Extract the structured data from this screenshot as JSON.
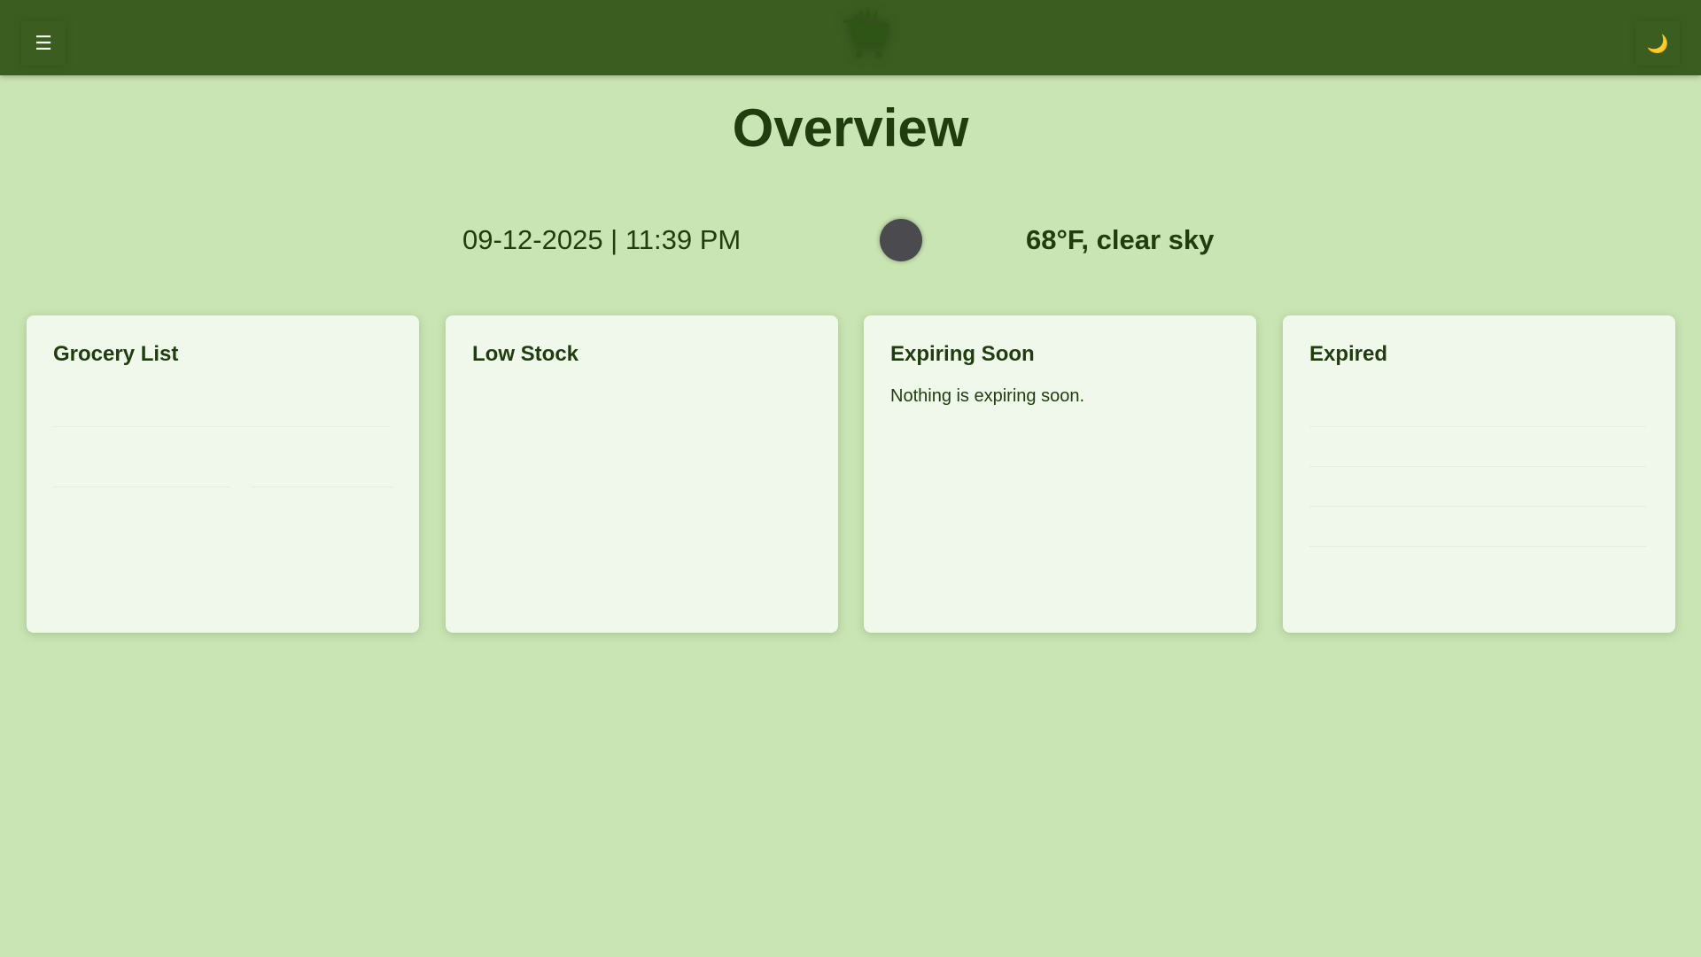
{
  "header": {
    "menu_icon": "☰",
    "theme_icon": "🌙",
    "logo_name": "grocery-cart-logo",
    "colors": {
      "bar": "#3b5e20",
      "background": "#cae5b4"
    }
  },
  "main": {
    "title": "Overview",
    "datetime": "09-12-2025 | 11:39 PM",
    "weather": "68°F, clear sky"
  },
  "cards": [
    {
      "title": "Grocery List",
      "message": ""
    },
    {
      "title": "Low Stock",
      "message": ""
    },
    {
      "title": "Expiring Soon",
      "message": "Nothing is expiring soon."
    },
    {
      "title": "Expired",
      "message": ""
    }
  ]
}
